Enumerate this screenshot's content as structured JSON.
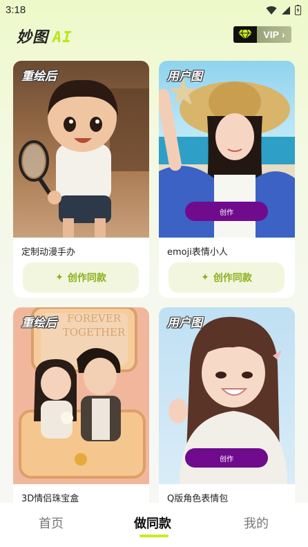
{
  "status": {
    "time": "3:18"
  },
  "header": {
    "logo_main": "妙图",
    "logo_ai": "AI",
    "vip_label": "VIP",
    "vip_arrow": "›"
  },
  "cards": [
    {
      "tag": "重绘后",
      "title": "定制动漫手办",
      "button": "创作同款"
    },
    {
      "tag": "用户图",
      "title": "emoji表情小人",
      "button": "创作同款",
      "pill": "创作"
    },
    {
      "tag": "重绘后",
      "title": "3D情侣珠宝盒",
      "box_text": "FOREVER TOGETHER"
    },
    {
      "tag": "用户图",
      "title": "Q版角色表情包",
      "pill": "创作"
    }
  ],
  "nav": {
    "home": "首页",
    "remake": "做同款",
    "mine": "我的"
  },
  "colors": {
    "accent": "#c9ec1f",
    "pill": "#6f0b8c",
    "button_text": "#8ab01b"
  }
}
